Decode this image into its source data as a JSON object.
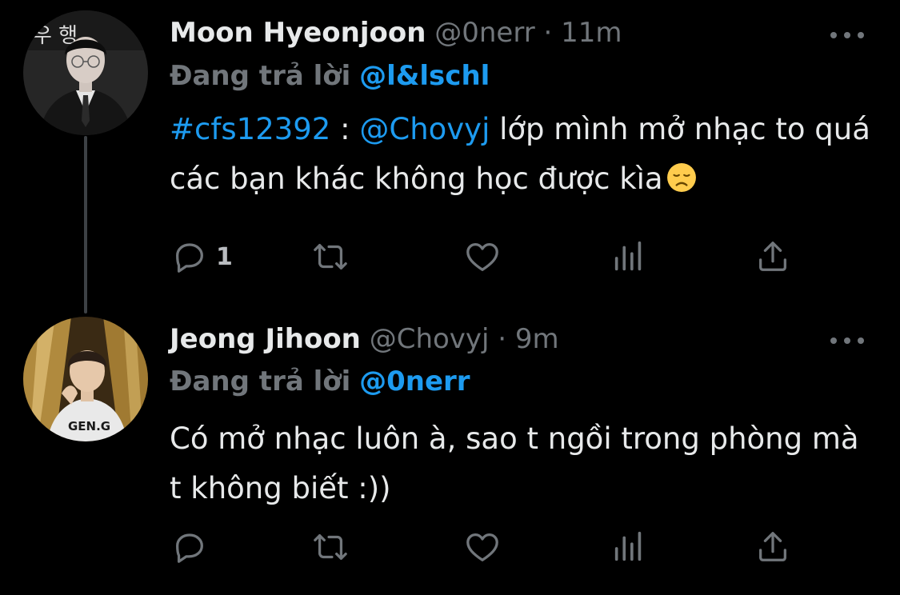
{
  "tweets": [
    {
      "display_name": "Moon Hyeonjoon",
      "handle": "@0nerr",
      "separator": "·",
      "time": "11m",
      "reply_label": "Đang trả lời",
      "reply_to": "@l&lschl",
      "body": {
        "hashtag": "#cfs12392",
        "sep": " : ",
        "mention": "@Chovyj",
        "text": " lớp mình mở nhạc to quá các bạn khác không học được kìa",
        "emoji": "disappointed-face"
      },
      "actions": {
        "reply_count": "1"
      },
      "avatar_text": "우 행",
      "icons": [
        "reply-icon",
        "retweet-icon",
        "like-icon",
        "views-icon",
        "share-icon",
        "more-icon"
      ]
    },
    {
      "display_name": "Jeong Jihoon",
      "handle": "@Chovyj",
      "separator": "·",
      "time": "9m",
      "reply_label": "Đang trả lời",
      "reply_to": "@0nerr",
      "body": {
        "text": "Có mở nhạc luôn à, sao t ngồi trong phòng mà t không biết :))"
      },
      "actions": {
        "reply_count": ""
      },
      "avatar_text": "GEN.G",
      "icons": [
        "reply-icon",
        "retweet-icon",
        "like-icon",
        "views-icon",
        "share-icon",
        "more-icon"
      ]
    }
  ],
  "colors": {
    "background": "#000000",
    "text_primary": "#e7e9ea",
    "text_secondary": "#71767b",
    "link": "#1d9bf0",
    "thread_line": "#3d4145"
  }
}
